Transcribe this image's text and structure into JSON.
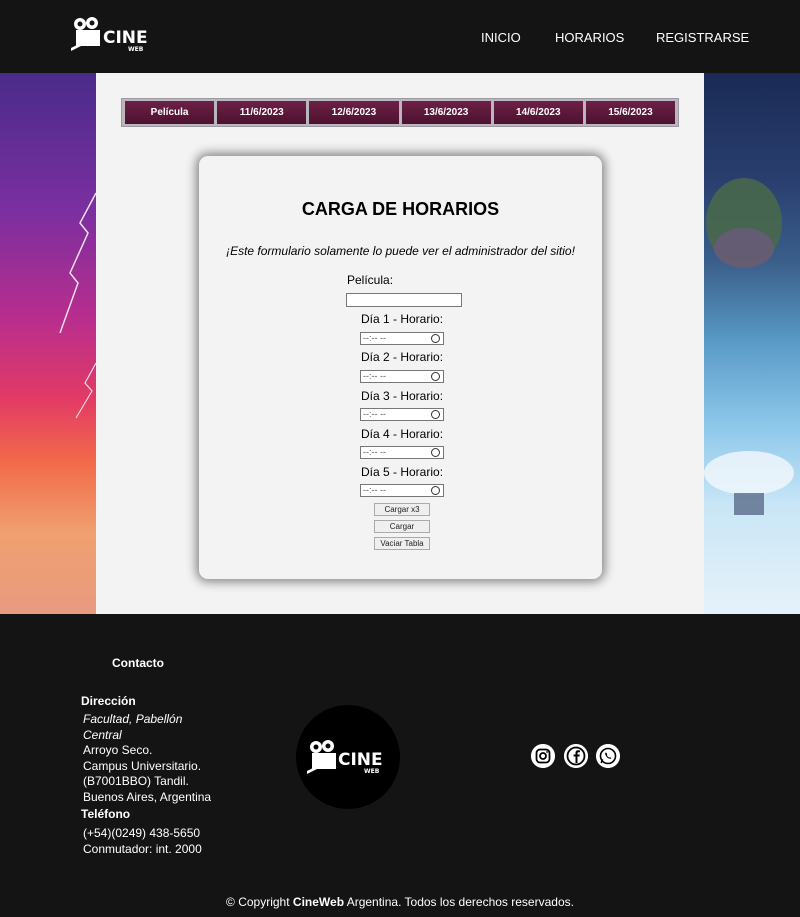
{
  "nav": {
    "inicio": "INICIO",
    "horarios": "HORARIOS",
    "registrarse": "REGISTRARSE"
  },
  "logo": {
    "text": "CINE",
    "sub": "WEB"
  },
  "table": {
    "headers": [
      "Película",
      "11/6/2023",
      "12/6/2023",
      "13/6/2023",
      "14/6/2023",
      "15/6/2023"
    ]
  },
  "form": {
    "title": "CARGA DE HORARIOS",
    "note": "¡Este formulario solamente lo puede ver el administrador del sitio!",
    "pelicula_label": "Película:",
    "pelicula_value": "",
    "days": [
      {
        "label": "Día 1 - Horario:",
        "placeholder": "--:-- --"
      },
      {
        "label": "Día 2 - Horario:",
        "placeholder": "--:-- --"
      },
      {
        "label": "Día 3 - Horario:",
        "placeholder": "--:-- --"
      },
      {
        "label": "Día 4 - Horario:",
        "placeholder": "--:-- --"
      },
      {
        "label": "Día 5 - Horario:",
        "placeholder": "--:-- --"
      }
    ],
    "btn_cargar_x3": "Cargar x3",
    "btn_cargar": "Cargar",
    "btn_vaciar": "Vaciar Tabla"
  },
  "footer": {
    "contacto": "Contacto",
    "direccion_heading": "Dirección",
    "address_italic_1": "Facultad, Pabellón",
    "address_italic_2": "Central",
    "address_lines": [
      "Arroyo Seco.",
      "Campus Universitario.",
      "(B7001BBO) Tandil.",
      "Buenos Aires, Argentina"
    ],
    "telefono_heading": "Teléfono",
    "phone_lines": [
      "(+54)(0249) 438-5650",
      "Conmutador: int. 2000"
    ],
    "copyright_prefix": "© Copyright ",
    "copyright_brand": "CineWeb",
    "copyright_suffix": " Argentina. Todos los derechos reservados.",
    "social_icons": [
      "instagram-icon",
      "facebook-icon",
      "whatsapp-icon"
    ]
  }
}
